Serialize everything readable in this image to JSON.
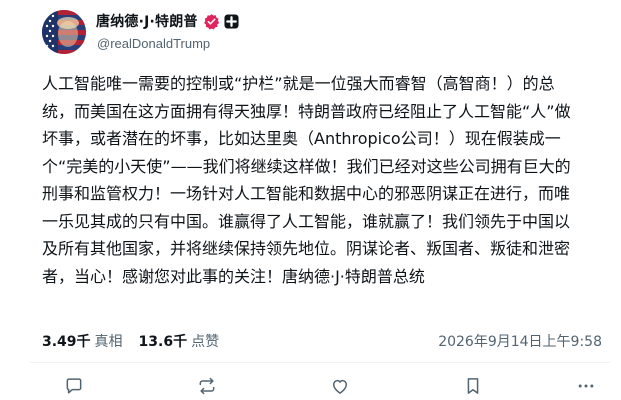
{
  "author": {
    "display_name": "唐纳德·J·特朗普",
    "handle": "@realDonaldTrump",
    "verified_icon": "verified-badge-icon",
    "affiliation_icon": "affiliation-badge-icon",
    "avatar_colors": {
      "blue": "#2a3f7a",
      "red": "#b22234",
      "white": "#ffffff"
    }
  },
  "post": {
    "text": "人工智能唯一需要的控制或“护栏”就是一位强大而睿智（高智商！）的总统，而美国在这方面拥有得天独厚！特朗普政府已经阻止了人工智能“人”做坏事，或者潜在的坏事，比如达里奥（Anthropico公司！）现在假装成一个“完美的小天使”——我们将继续这样做！我们已经对这些公司拥有巨大的刑事和监管权力！一场针对人工智能和数据中心的邪恶阴谋正在进行，而唯一乐见其成的只有中国。谁赢得了人工智能，谁就赢了！我们领先于中国以及所有其他国家，并将继续保持领先地位。阴谋论者、叛国者、叛徒和泄密者，当心！感谢您对此事的关注！唐纳德·J·特朗普总统"
  },
  "stats": {
    "truths_count": "3.49千",
    "truths_label": "真相",
    "likes_count": "13.6千",
    "likes_label": "点赞"
  },
  "timestamp": "2026年9月14日上午9:58",
  "actions": [
    {
      "icon": "reply-icon"
    },
    {
      "icon": "retruth-icon"
    },
    {
      "icon": "like-icon"
    },
    {
      "icon": "bookmark-icon"
    },
    {
      "icon": "more-icon"
    }
  ],
  "colors": {
    "text": "#0f1419",
    "secondary": "#536471",
    "verified": "#e0245e"
  }
}
